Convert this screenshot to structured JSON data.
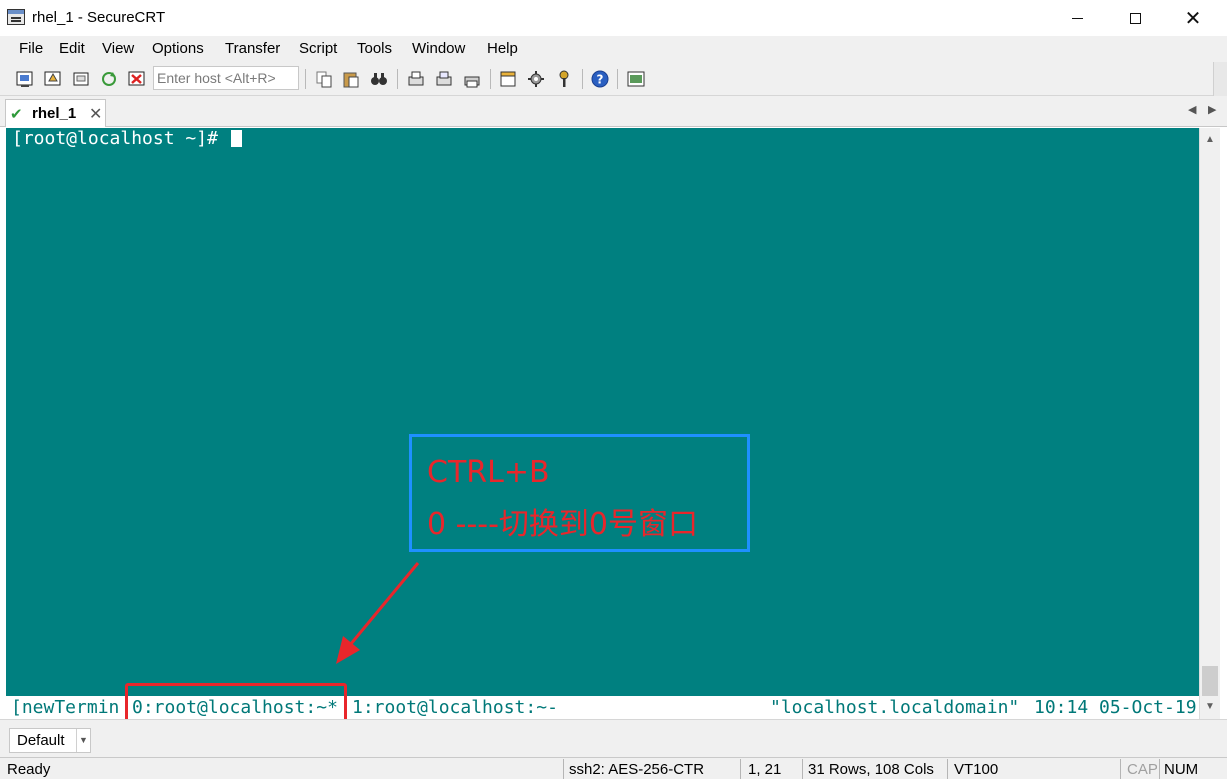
{
  "window": {
    "title": "rhel_1 - SecureCRT"
  },
  "menu": [
    "File",
    "Edit",
    "View",
    "Options",
    "Transfer",
    "Script",
    "Tools",
    "Window",
    "Help"
  ],
  "toolbar": {
    "host_placeholder": "Enter host <Alt+R>"
  },
  "tab": {
    "label": "rhel_1"
  },
  "terminal": {
    "prompt": "[root@localhost ~]# ",
    "status": {
      "session": "[newTermin",
      "window0": "0:root@localhost:~*",
      "window1": "1:root@localhost:~-",
      "host": "\"localhost.localdomain\"",
      "time": "10:14",
      "date": "05-Oct-19"
    }
  },
  "annotation": {
    "line1": "CTRL+B",
    "line2": "0 ----切换到0号窗口"
  },
  "session_selector": {
    "value": "Default"
  },
  "statusbar": {
    "state": "Ready",
    "cipher": "ssh2: AES-256-CTR",
    "position": "1,  21",
    "size": "31 Rows, 108 Cols",
    "emulation": "VT100",
    "cap": "CAP",
    "num": "NUM"
  },
  "colors": {
    "terminal_bg": "#008080",
    "terminal_fg": "#ffffff",
    "status_fg": "#007878",
    "annotation_text": "#e8262b",
    "annotation_box": "#1e90ff"
  },
  "icons": [
    "connect-icon",
    "quick-connect-icon",
    "connect-tab-icon",
    "reconnect-icon",
    "disconnect-icon",
    "copy-icon",
    "paste-icon",
    "find-icon",
    "print-icon",
    "print-setup-icon",
    "printer-icon",
    "session-options-icon",
    "global-options-icon",
    "key-icon",
    "help-icon",
    "sftp-icon"
  ]
}
